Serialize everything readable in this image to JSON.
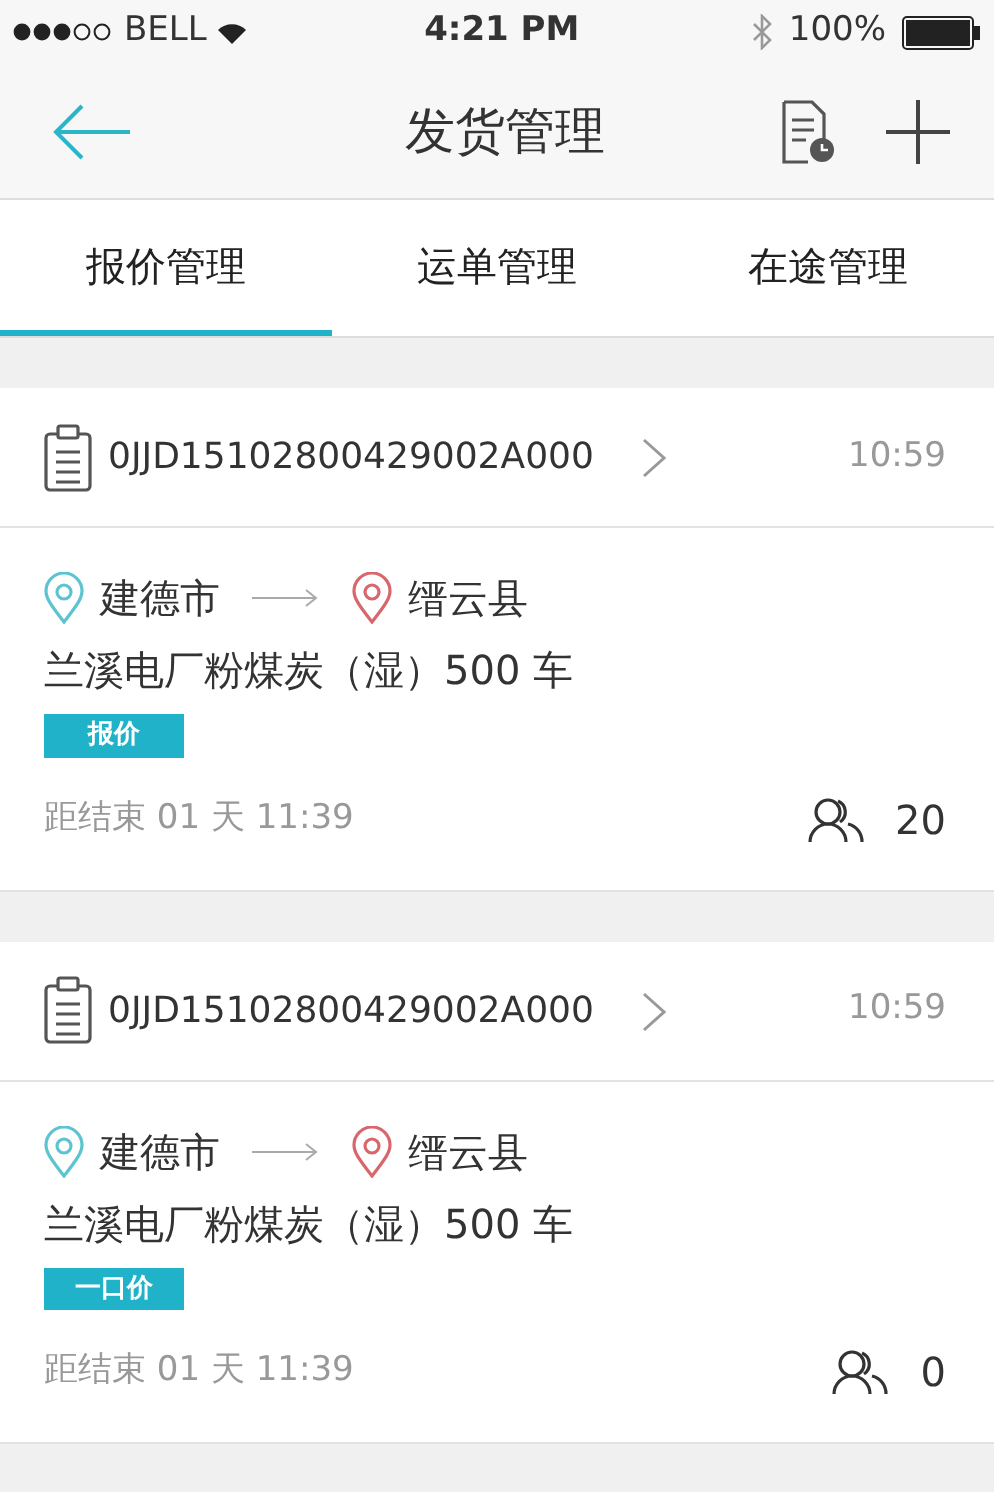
{
  "status_bar": {
    "carrier": "BELL",
    "time": "4:21 PM",
    "battery": "100%"
  },
  "nav": {
    "title": "发货管理"
  },
  "tabs": [
    {
      "label": "报价管理",
      "selected": true
    },
    {
      "label": "运单管理",
      "selected": false
    },
    {
      "label": "在途管理",
      "selected": false
    }
  ],
  "orders": [
    {
      "order_no": "0JJD15102800429002A000",
      "time": "10:59",
      "origin": "建德市",
      "destination": "缙云县",
      "cargo": "兰溪电厂粉煤炭（湿）500 车",
      "tag": "报价",
      "countdown": "距结束 01 天 11:39",
      "bidders": "20"
    },
    {
      "order_no": "0JJD15102800429002A000",
      "time": "10:59",
      "origin": "建德市",
      "destination": "缙云县",
      "cargo": "兰溪电厂粉煤炭（湿）500 车",
      "tag": "一口价",
      "countdown": "距结束 01 天 11:39",
      "bidders": "0"
    }
  ]
}
